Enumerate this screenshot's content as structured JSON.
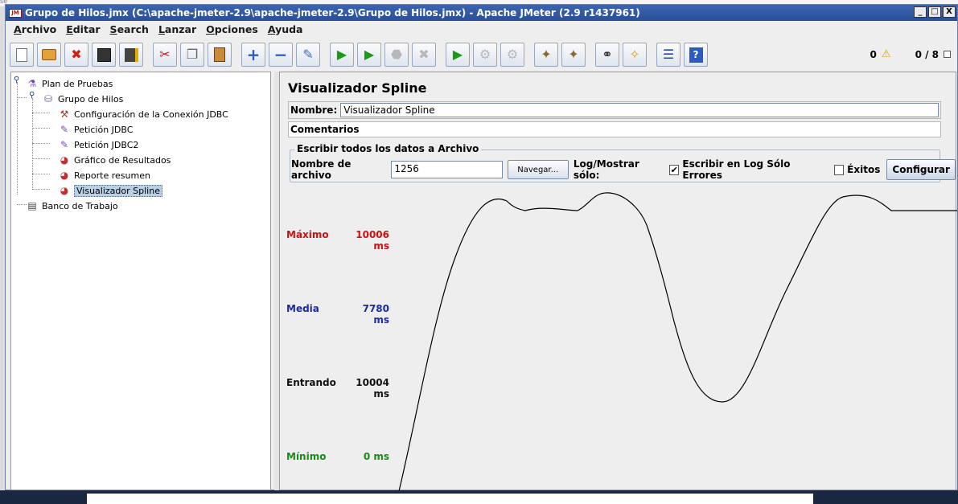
{
  "window": {
    "title": "Grupo de Hilos.jmx (C:\\apache-jmeter-2.9\\apache-jmeter-2.9\\Grupo de Hilos.jmx) - Apache JMeter (2.9 r1437961)",
    "minimize": "_",
    "maximize": "□",
    "close": "X"
  },
  "menu": {
    "items": [
      "Archivo",
      "Editar",
      "Search",
      "Lanzar",
      "Opciones",
      "Ayuda"
    ]
  },
  "toolbar": {
    "status_errors": "0",
    "status_threads": "0 / 8"
  },
  "tree": {
    "items": [
      {
        "label": "Plan de Pruebas",
        "icon": "flask-icon"
      },
      {
        "label": "Grupo de Hilos",
        "icon": "spool-icon"
      },
      {
        "label": "Configuración de la Conexión JDBC",
        "icon": "config-icon"
      },
      {
        "label": "Petición JDBC",
        "icon": "pipette-icon"
      },
      {
        "label": "Petición JDBC2",
        "icon": "pipette-icon"
      },
      {
        "label": "Gráfico de Resultados",
        "icon": "chart-icon"
      },
      {
        "label": "Reporte resumen",
        "icon": "chart-icon"
      },
      {
        "label": "Visualizador Spline",
        "icon": "chart-icon"
      },
      {
        "label": "Banco de Trabajo",
        "icon": "workbench-icon"
      }
    ]
  },
  "panel": {
    "title": "Visualizador Spline",
    "name_label": "Nombre:",
    "name_value": "Visualizador Spline",
    "comments_label": "Comentarios",
    "file_section": "Escribir todos los datos a Archivo",
    "filename_label": "Nombre de archivo",
    "filename_value": "1256",
    "browse": "Navegar...",
    "log_label": "Log/Mostrar sólo:",
    "errors_only": "Escribir en Log Sólo Errores",
    "successes": "Éxitos",
    "configure": "Configurar"
  },
  "stats": {
    "max_label": "Máximo",
    "max_value": "10006 ms",
    "avg_label": "Media",
    "avg_value": "7780 ms",
    "incoming_label": "Entrando",
    "incoming_value": "10004 ms",
    "min_label": "Mínimo",
    "min_value": "0 ms"
  },
  "colors": {
    "max": "#d01010",
    "avg": "#1a2aa8",
    "incoming": "#111111",
    "min": "#1b8a1b"
  }
}
